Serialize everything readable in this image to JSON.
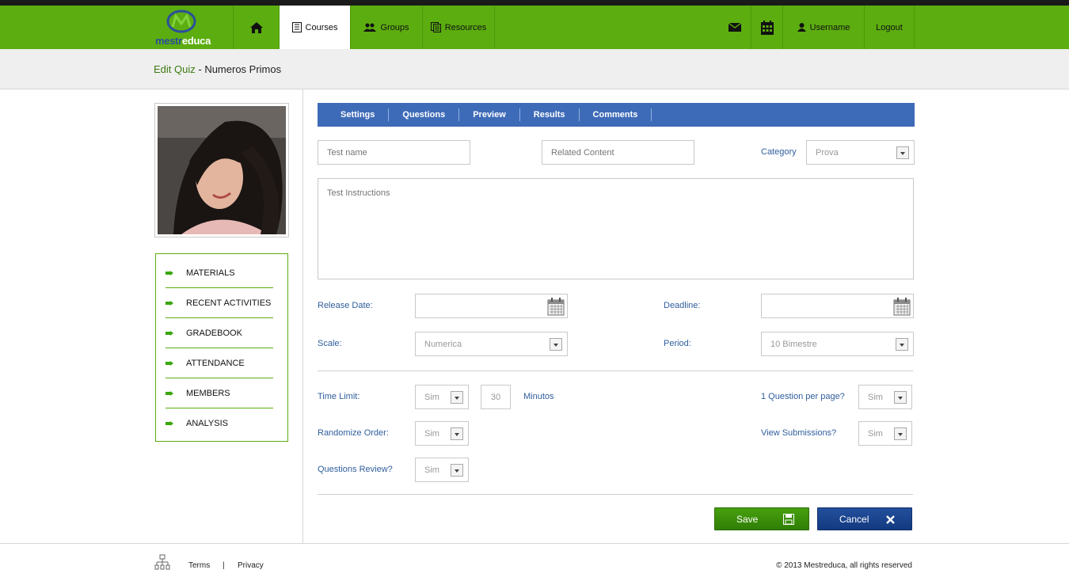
{
  "brand": {
    "logo_word_1": "mestr",
    "logo_word_2": "educa",
    "primary": "#5cad0f",
    "tab_blue": "#3e6bb8"
  },
  "nav": {
    "home_icon": "home-icon",
    "courses": "Courses",
    "groups": "Groups",
    "resources": "Resources",
    "username": "Username",
    "logout": "Logout"
  },
  "page": {
    "crumb_link": "Edit Quiz",
    "crumb_sep": " - ",
    "crumb_title": "Numeros Primos"
  },
  "sidemenu": {
    "items": [
      "MATERIALS",
      "RECENT ACTIVITIES",
      "GRADEBOOK",
      "ATTENDANCE",
      "MEMBERS",
      "ANALYSIS"
    ]
  },
  "tabs": [
    "Settings",
    "Questions",
    "Preview",
    "Results",
    "Comments"
  ],
  "form": {
    "test_name_placeholder": "Test name",
    "related_content_placeholder": "Related Content",
    "category_label": "Category",
    "category_value": "Prova",
    "instructions_placeholder": "Test Instructions",
    "release_date_label": "Release Date:",
    "deadline_label": "Deadline:",
    "scale_label": "Scale:",
    "scale_value": "Numerica",
    "period_label": "Period:",
    "period_value": "10 Bimestre",
    "time_limit_label": "Time Limit:",
    "time_limit_value": "Sim",
    "minutes_value": "30",
    "minutes_label": "Minutos",
    "one_question_label": "1 Question per page?",
    "one_question_value": "Sim",
    "randomize_label": "Randomize Order:",
    "randomize_value": "Sim",
    "view_submissions_label": "View Submissions?",
    "view_submissions_value": "Sim",
    "questions_review_label": "Questions Review?",
    "questions_review_value": "Sim"
  },
  "actions": {
    "save": "Save",
    "cancel": "Cancel"
  },
  "footer": {
    "terms": "Terms",
    "sep": "|",
    "privacy": "Privacy",
    "copyright": "© 2013 Mestreduca, all rights reserved"
  }
}
